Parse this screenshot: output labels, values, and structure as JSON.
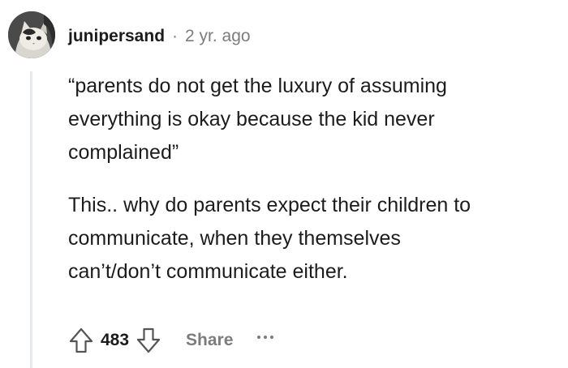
{
  "comment": {
    "author": "junipersand",
    "separator": "·",
    "timestamp": "2 yr. ago",
    "paragraphs": [
      "“parents do not get the luxury of assuming\neverything is okay because the kid never\ncomplained”",
      "This.. why do parents expect their children to\ncommunicate, when they themselves\ncan’t/don’t communicate either."
    ],
    "score": "483",
    "share_label": "Share"
  },
  "icons": {
    "upvote": "arrow-up-icon",
    "downvote": "arrow-down-icon",
    "more": "more-options-icon"
  },
  "colors": {
    "text": "#1c1c1c",
    "muted": "#7c7c7c",
    "thread_line": "#e7eaec"
  }
}
